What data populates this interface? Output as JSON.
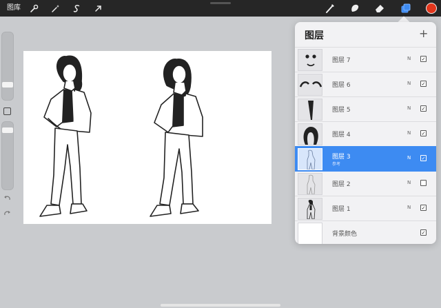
{
  "toolbar": {
    "gallery_label": "图库",
    "left_tools": [
      "wrench-icon",
      "magic-wand-icon",
      "selection-s-icon",
      "transform-arrow-icon"
    ],
    "right_tools": [
      "brush-icon",
      "smudge-icon",
      "eraser-icon",
      "layers-icon"
    ],
    "current_color": "#e2361c",
    "accent": "#3d8bf2"
  },
  "layers_panel": {
    "title": "图层",
    "add_label": "+",
    "layers": [
      {
        "name": "图层 7",
        "blend": "N",
        "visible": true,
        "selected": false,
        "sublabel": ""
      },
      {
        "name": "图层 6",
        "blend": "N",
        "visible": true,
        "selected": false,
        "sublabel": ""
      },
      {
        "name": "图层 5",
        "blend": "N",
        "visible": true,
        "selected": false,
        "sublabel": ""
      },
      {
        "name": "图层 4",
        "blend": "N",
        "visible": true,
        "selected": false,
        "sublabel": ""
      },
      {
        "name": "图层 3",
        "blend": "N",
        "visible": true,
        "selected": true,
        "sublabel": "参考"
      },
      {
        "name": "图层 2",
        "blend": "N",
        "visible": false,
        "selected": false,
        "sublabel": ""
      },
      {
        "name": "图层 1",
        "blend": "N",
        "visible": true,
        "selected": false,
        "sublabel": ""
      }
    ],
    "background": {
      "name": "背景颜色",
      "visible": true
    }
  }
}
